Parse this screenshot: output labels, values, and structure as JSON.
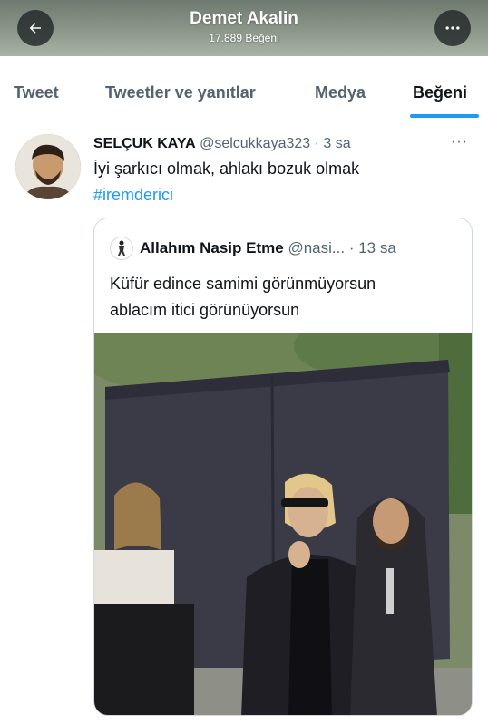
{
  "header": {
    "title": "Demet Akalin",
    "subtitle": "17.889 Beğeni",
    "back_icon": "arrow-left-icon",
    "more_icon": "more-horizontal-icon"
  },
  "tabs": [
    {
      "label": "Tweet",
      "active": false
    },
    {
      "label": "Tweetler ve yanıtlar",
      "active": false
    },
    {
      "label": "Medya",
      "active": false
    },
    {
      "label": "Beğeni",
      "active": true
    }
  ],
  "tweet": {
    "name": "SELÇUK KAYA",
    "handle": "@selcukkaya323",
    "time": "· 3 sa",
    "more": "···",
    "text": "İyi şarkıcı olmak, ahlakı bozuk olmak",
    "hashtag": "#iremderici",
    "quote": {
      "name": "Allahım Nasip Etme",
      "handle": "@nasi...",
      "time": "· 13 sa",
      "text_line1": "Küfür edince samimi görünmüyorsun",
      "text_line2": "ablacım itici görünüyorsun"
    }
  },
  "colors": {
    "accent": "#1d9bf0",
    "text_primary": "#0f1419",
    "text_secondary": "#536471",
    "border": "#cfd9de"
  }
}
